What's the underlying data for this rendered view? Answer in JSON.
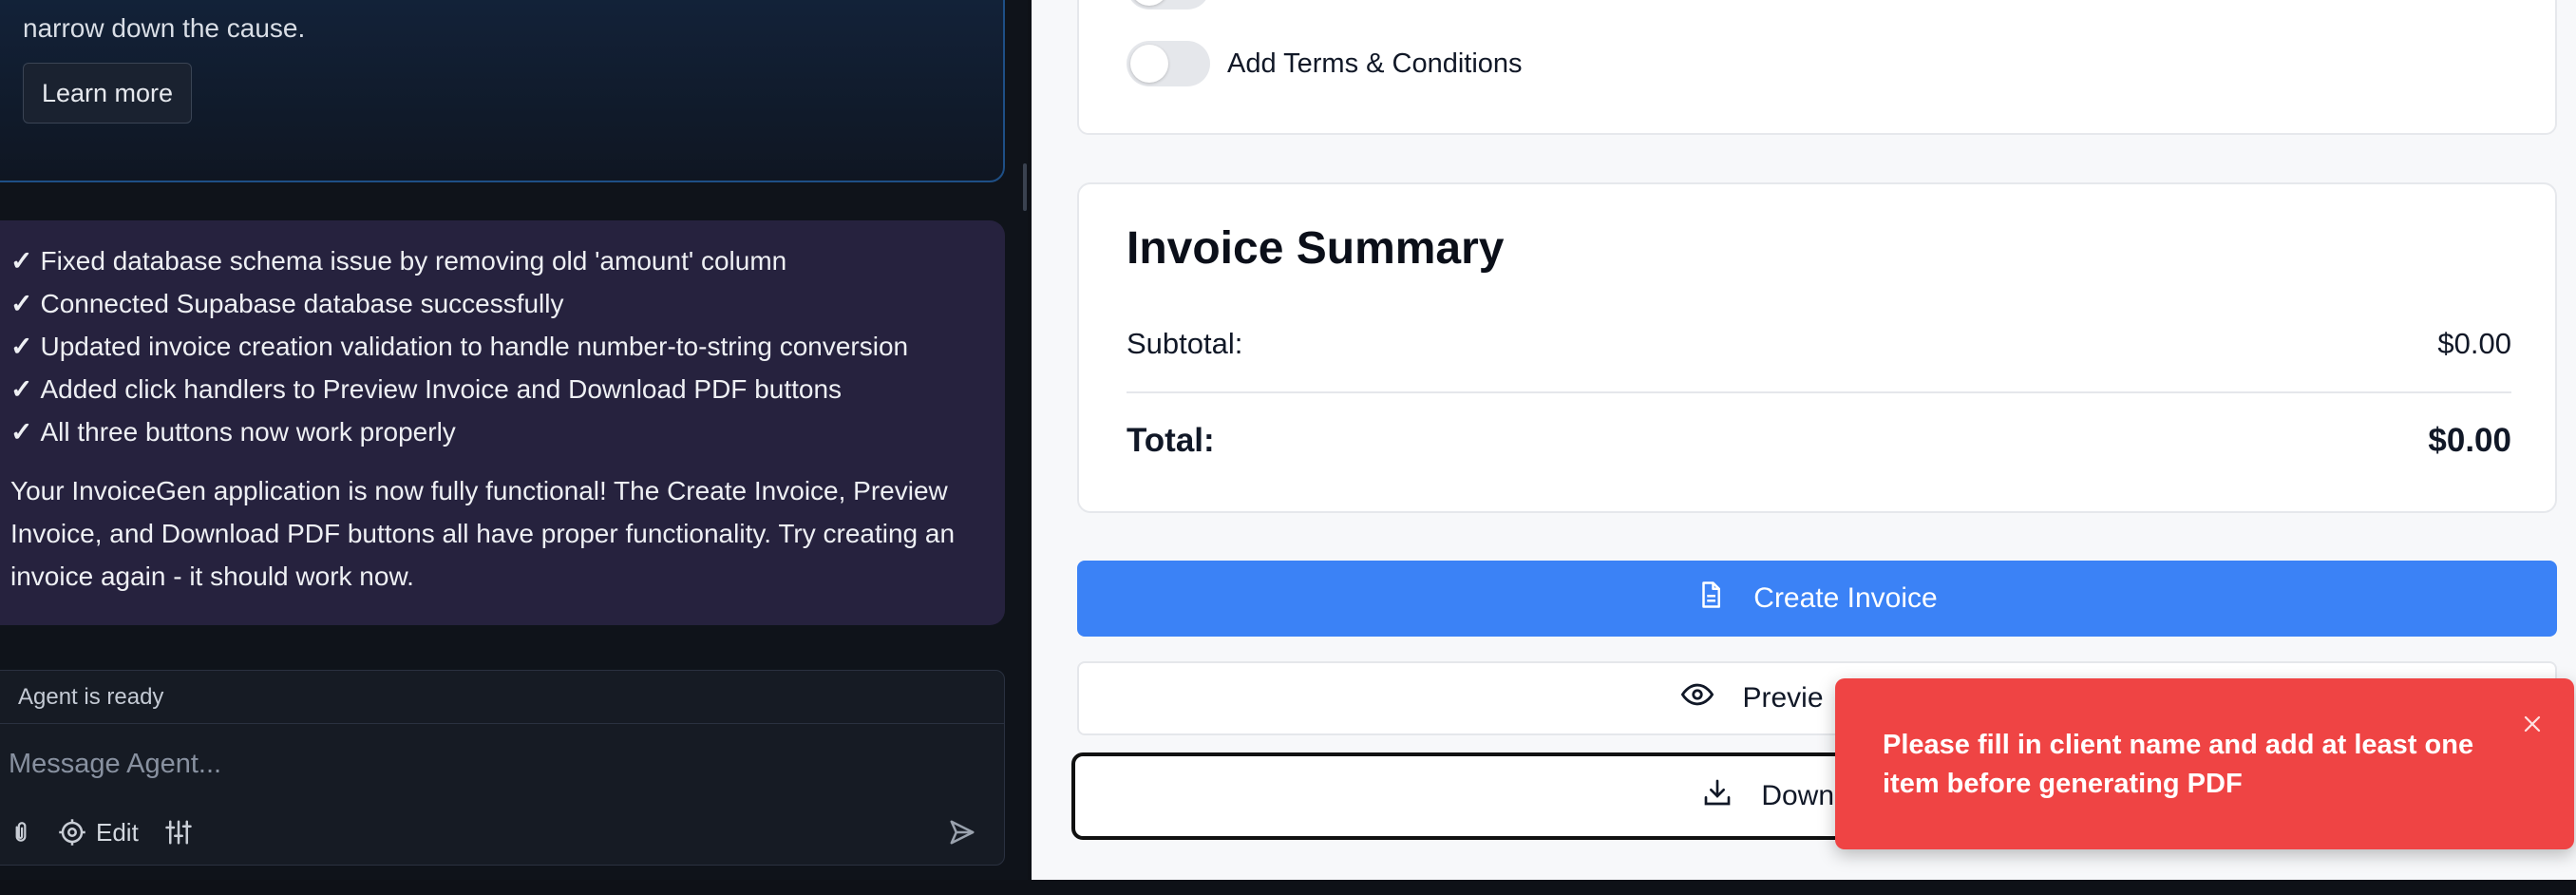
{
  "agent_panel": {
    "info_card": {
      "text": "or when data is being saved. Helping the Agent understand the timing helps narrow down the cause.",
      "learn_more_label": "Learn more"
    },
    "message": {
      "checklist": [
        "Fixed database schema issue by removing old 'amount' column",
        "Connected Supabase database successfully",
        "Updated invoice creation validation to handle number-to-string conversion",
        "Added click handlers to Preview Invoice and Download PDF buttons",
        "All three buttons now work properly"
      ],
      "check_glyph": "✓",
      "summary": "Your InvoiceGen application is now fully functional! The Create Invoice, Preview Invoice, and Download PDF buttons all have proper functionality. Try creating an invoice again - it should work now."
    },
    "composer": {
      "status": "Agent is ready",
      "placeholder": "Message Agent...",
      "tools": {
        "attach_icon": "paperclip-icon",
        "edit_label": "Edit",
        "edit_icon": "target-icon",
        "settings_icon": "sliders-icon",
        "send_icon": "send-icon"
      }
    }
  },
  "invoice_app": {
    "options": {
      "terms_label": "Add Terms & Conditions"
    },
    "summary": {
      "title": "Invoice Summary",
      "subtotal_label": "Subtotal:",
      "subtotal_value": "$0.00",
      "total_label": "Total:",
      "total_value": "$0.00"
    },
    "buttons": {
      "create_label": "Create Invoice",
      "create_icon": "document-icon",
      "preview_label": "Previe",
      "preview_icon": "eye-icon",
      "download_label": "Downl",
      "download_icon": "download-icon"
    }
  },
  "toast": {
    "message": "Please fill in client name and add at least one item before generating PDF",
    "close_icon": "close-icon"
  },
  "colors": {
    "primary_blue": "#3b82f6",
    "toast_red": "#ef4444",
    "agent_message_bg": "#26223e"
  }
}
